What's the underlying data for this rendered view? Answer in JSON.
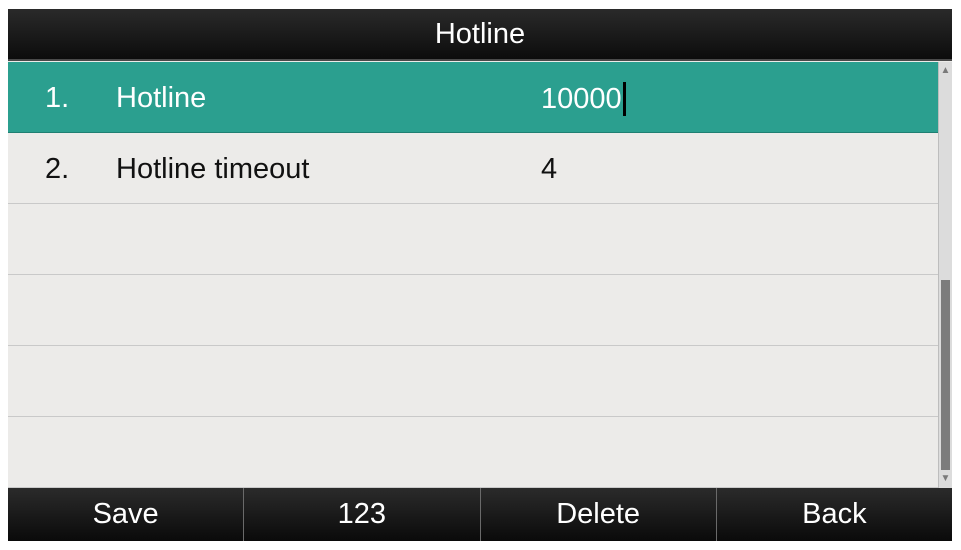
{
  "title": "Hotline",
  "rows": [
    {
      "num": "1.",
      "label": "Hotline",
      "value": "10000",
      "selected": true
    },
    {
      "num": "2.",
      "label": "Hotline timeout",
      "value": "4",
      "selected": false
    }
  ],
  "softkeys": {
    "save": "Save",
    "input_mode": "123",
    "delete": "Delete",
    "back": "Back"
  },
  "colors": {
    "selected_row": "#2b9f8f",
    "background": "#ecebe9",
    "bar": "#111111"
  },
  "icons": {
    "scroll_up": "scroll-up-arrow-icon",
    "scroll_down": "scroll-down-arrow-icon"
  }
}
